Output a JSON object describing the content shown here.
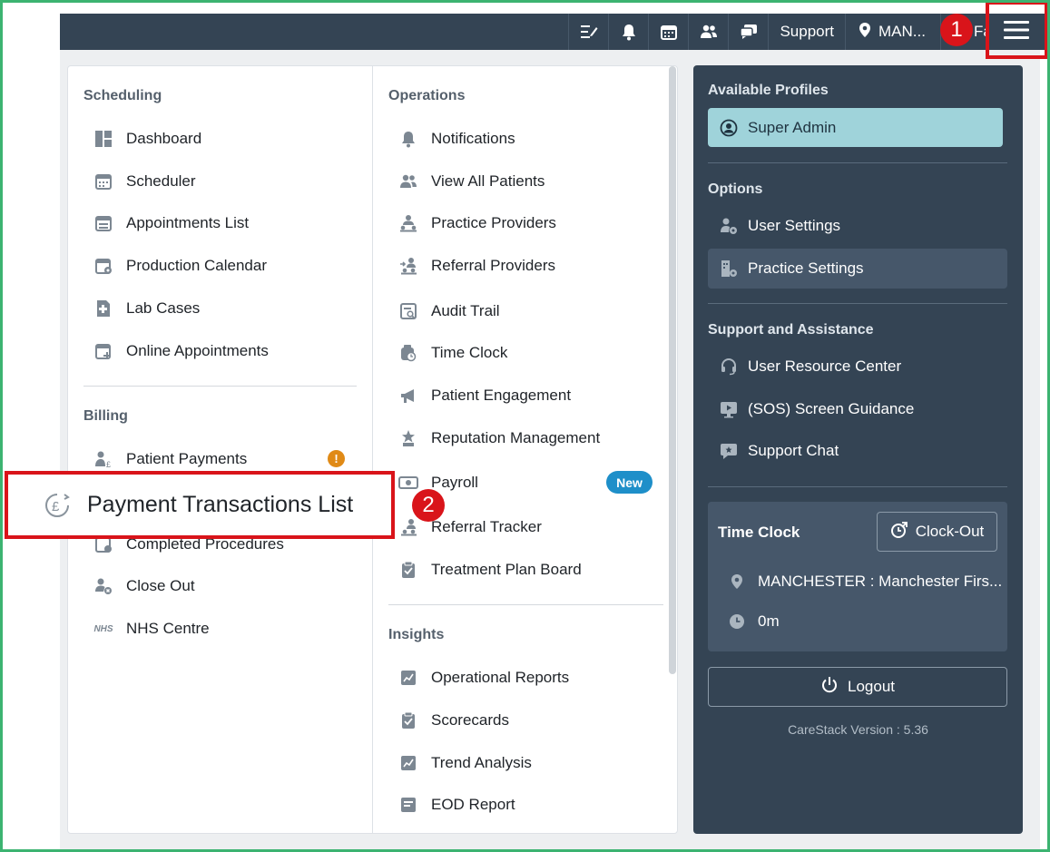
{
  "topbar": {
    "icons": [
      "task-list-icon",
      "bell-icon",
      "calendar-icon",
      "users-icon",
      "chat-icon"
    ],
    "support_label": "Support",
    "location_label": "MAN...",
    "fa_label": "Fa",
    "menu_icon": "hamburger-menu-icon"
  },
  "annotations": {
    "step1": "1",
    "step2": "2"
  },
  "scheduling": {
    "title": "Scheduling",
    "items": [
      "Dashboard",
      "Scheduler",
      "Appointments List",
      "Production Calendar",
      "Lab Cases",
      "Online Appointments"
    ]
  },
  "billing": {
    "title": "Billing",
    "items": [
      "Patient Payments",
      "Completed Procedures",
      "Close Out",
      "NHS Centre"
    ],
    "warning_badge": "!",
    "nhs_icon_text": "NHS"
  },
  "popout": {
    "label": "Payment Transactions List",
    "icon": "pound-currency-icon"
  },
  "operations": {
    "title": "Operations",
    "items": [
      "Notifications",
      "View All Patients",
      "Practice Providers",
      "Referral Providers",
      "Audit Trail",
      "Time Clock",
      "Patient Engagement",
      "Reputation Management",
      "Payroll",
      "Referral Tracker",
      "Treatment Plan Board"
    ],
    "new_badge": "New"
  },
  "insights": {
    "title": "Insights",
    "items": [
      "Operational Reports",
      "Scorecards",
      "Trend Analysis",
      "EOD Report"
    ]
  },
  "sidebar": {
    "profiles_title": "Available Profiles",
    "profile": "Super Admin",
    "options_title": "Options",
    "options": [
      "User Settings",
      "Practice Settings"
    ],
    "support_title": "Support and Assistance",
    "support_items": [
      "User Resource Center",
      "(SOS) Screen Guidance",
      "Support Chat"
    ],
    "time_clock": {
      "title": "Time Clock",
      "clock_out": "Clock-Out",
      "location": "MANCHESTER : Manchester Firs...",
      "elapsed": "0m"
    },
    "logout": "Logout",
    "version": "CareStack Version : 5.36"
  },
  "colors": {
    "topbar": "#344454",
    "accent_red": "#d9141a",
    "profile_highlight": "#9fd3da",
    "new_badge": "#1e8fc9",
    "warning": "#e08a16",
    "frame": "#3cb371"
  }
}
